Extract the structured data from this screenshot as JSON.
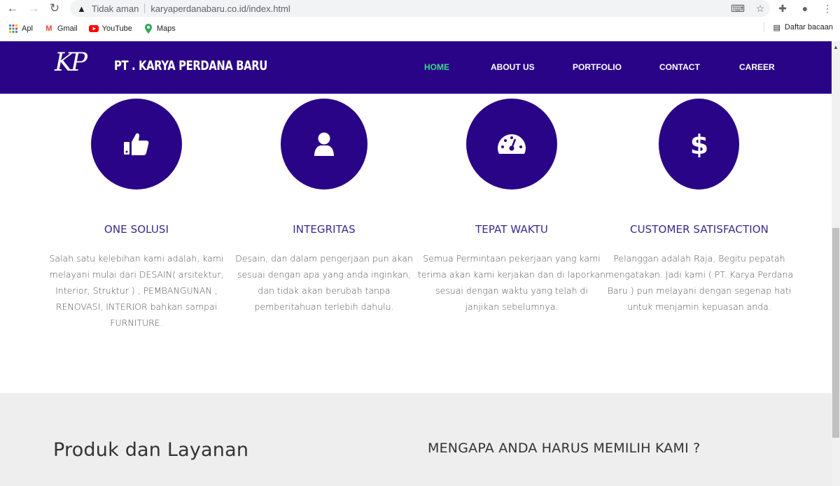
{
  "browser": {
    "insecure_label": "Tidak aman",
    "url": "karyaperdanabaru.co.id/index.html",
    "bookmarks": [
      {
        "label": "Apl",
        "icon": "apps-grid-icon"
      },
      {
        "label": "Gmail",
        "icon": "gmail-icon"
      },
      {
        "label": "YouTube",
        "icon": "youtube-icon"
      },
      {
        "label": "Maps",
        "icon": "maps-pin-icon"
      }
    ],
    "reading_list": "Daftar bacaan"
  },
  "header": {
    "logo_mark": "KP",
    "brand": "PT . KARYA PERDANA BARU",
    "nav": [
      {
        "label": "HOME",
        "active": true
      },
      {
        "label": "ABOUT US",
        "active": false
      },
      {
        "label": "PORTFOLIO",
        "active": false
      },
      {
        "label": "CONTACT",
        "active": false
      },
      {
        "label": "CAREER",
        "active": false
      }
    ],
    "colors": {
      "background": "#2a0487",
      "active": "#3dd68c"
    }
  },
  "features": [
    {
      "icon": "thumbs-up-icon",
      "title": "ONE SOLUSI",
      "text": "Salah satu kelebihan kami adalah, kami melayani mulai dari DESAIN( arsitektur, Interior, Struktur ) , PEMBANGUNAN , RENOVASI, INTERIOR bahkan sampai FURNITURE."
    },
    {
      "icon": "user-icon",
      "title": "INTEGRITAS",
      "text": "Desain, dan dalam pengerjaan pun akan sesuai dengan apa yang anda inginkan, dan tidak akan berubah tanpa pemberitahuan terlebih dahulu."
    },
    {
      "icon": "speedometer-icon",
      "title": "TEPAT WAKTU",
      "text": "Semua Permintaan pekerjaan yang kami terima akan kami kerjakan dan di laporkan sesuai dengan waktu yang telah di janjikan sebelumnya."
    },
    {
      "icon": "dollar-icon",
      "title": "CUSTOMER SATISFACTION",
      "text": "Pelanggan adalah Raja, Begitu pepatah mengatakan. Jadi kami ( PT. Karya Perdana Baru ) pun melayani dengan segenap hati untuk menjamin kepuasan anda."
    }
  ],
  "bottom": {
    "left_heading": "Produk dan Layanan",
    "right_heading": "MENGAPA ANDA HARUS MEMILIH KAMI ?"
  }
}
